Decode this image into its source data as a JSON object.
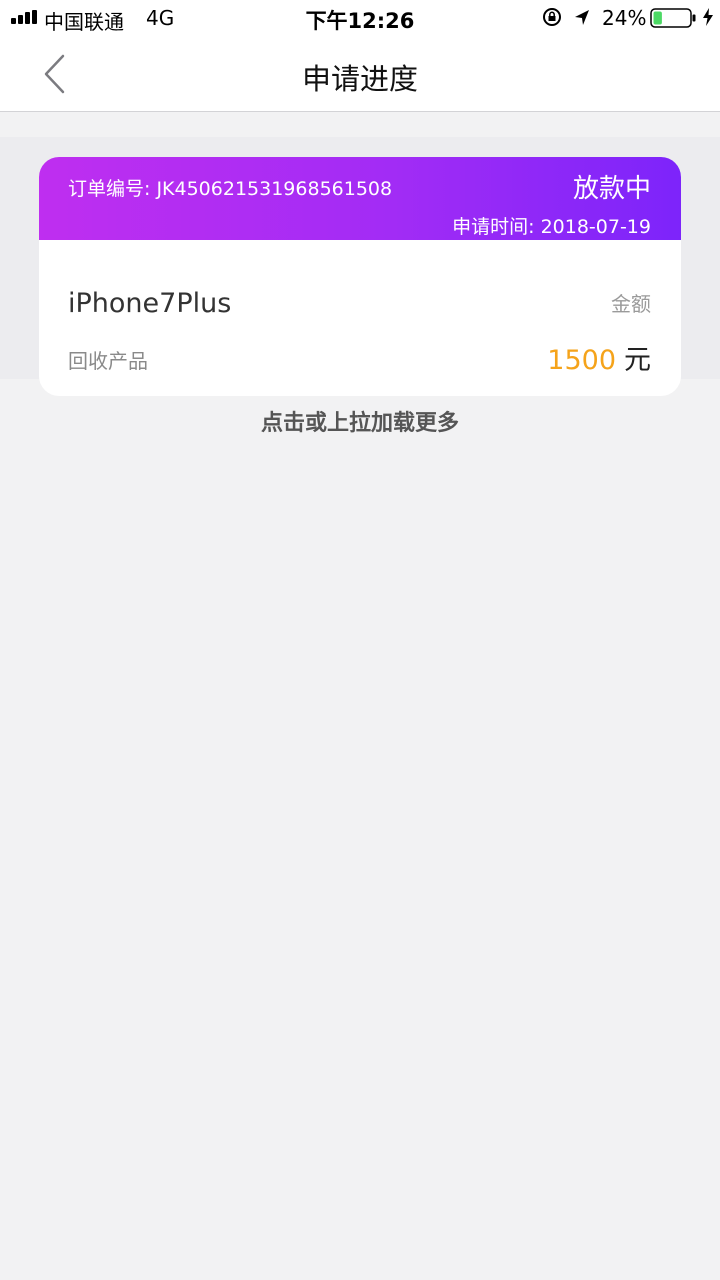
{
  "status_bar": {
    "carrier": "中国联通",
    "network": "4G",
    "time": "下午12:26",
    "battery_percent": "24%",
    "icons": [
      "signal-icon",
      "rotation-lock-icon",
      "location-icon",
      "battery-icon",
      "charging-icon"
    ],
    "battery_level": 0.24,
    "battery_color": "#4cd964"
  },
  "nav": {
    "title": "申请进度",
    "back_icon": "chevron-left-icon"
  },
  "orders": [
    {
      "order_number": "订单编号: JK450621531968561508",
      "status": "放款中",
      "apply_time": "申请时间: 2018-07-19",
      "product_name": "iPhone7Plus",
      "product_label": "回收产品",
      "amount_label": "金额",
      "amount": "1500",
      "unit": "元"
    }
  ],
  "load_more": "点击或上拉加载更多",
  "colors": {
    "header_gradient_start": "#bf2ef0",
    "header_gradient_end": "#7d24fa",
    "amount": "#f5a31a",
    "background": "#f2f2f3"
  }
}
